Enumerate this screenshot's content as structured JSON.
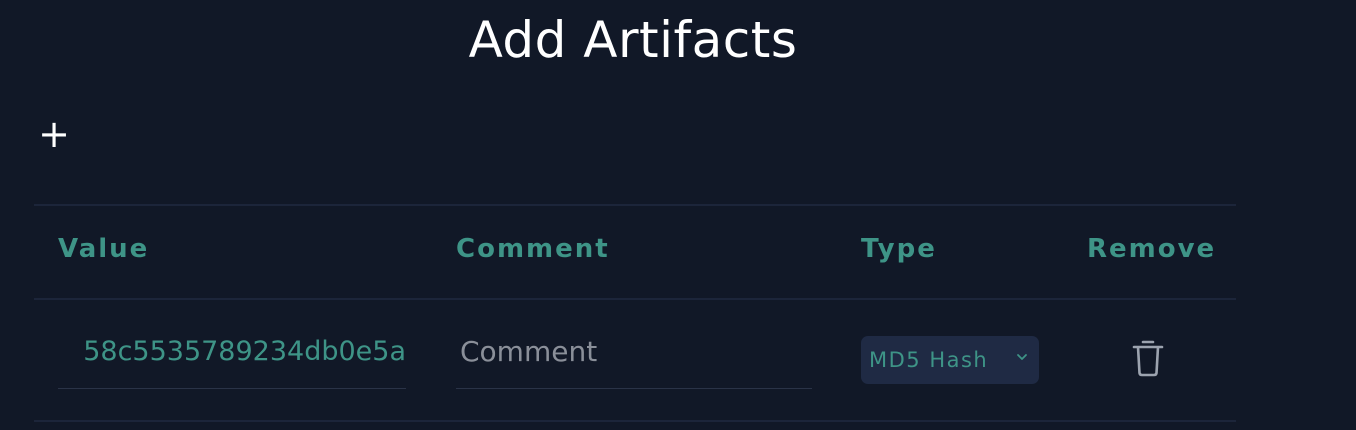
{
  "title": "Add Artifacts",
  "add_button": {
    "label": "+"
  },
  "table": {
    "headers": {
      "value": "Value",
      "comment": "Comment",
      "type": "Type",
      "remove": "Remove"
    },
    "rows": [
      {
        "value": "58c5535789234db0e5a",
        "comment": "",
        "comment_placeholder": "Comment",
        "type": "MD5 Hash",
        "remove_icon": "trash-icon"
      }
    ]
  },
  "colors": {
    "background": "#111827",
    "accent": "#3e9487",
    "select_bg": "#1f2a44",
    "icon": "#9ca3af"
  }
}
